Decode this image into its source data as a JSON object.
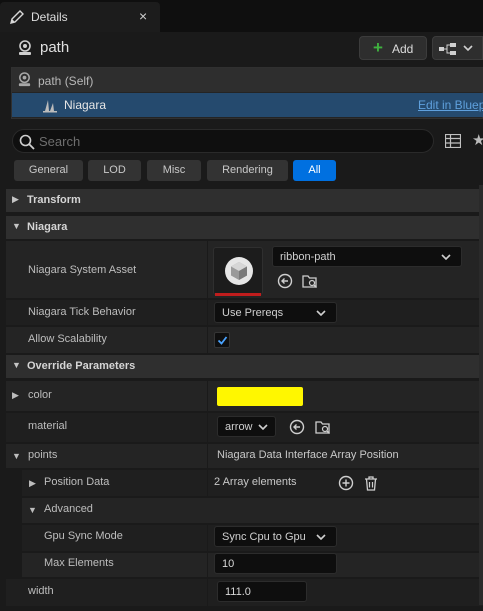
{
  "tab": {
    "title": "Details",
    "close": "×",
    "icon": "pencil-icon"
  },
  "header": {
    "actor_name": "path",
    "add_label": "Add",
    "add_icon": "plus-icon",
    "blueprint_icon": "blueprint-options-icon"
  },
  "tree": {
    "self_label": "path (Self)",
    "component_label": "Niagara",
    "edit_link": "Edit in Bluep"
  },
  "search": {
    "placeholder": "Search"
  },
  "filters": [
    "General",
    "LOD",
    "Misc",
    "Rendering",
    "All"
  ],
  "active_filter": "All",
  "sections": {
    "transform": "Transform",
    "niagara": "Niagara",
    "override": "Override Parameters"
  },
  "niagara": {
    "system_asset_label": "Niagara System Asset",
    "system_asset_value": "ribbon-path",
    "tick_behavior_label": "Niagara Tick Behavior",
    "tick_behavior_value": "Use Prereqs",
    "allow_scalability_label": "Allow Scalability",
    "allow_scalability_checked": true
  },
  "override": {
    "color_label": "color",
    "color_value": "#fff700",
    "material_label": "material",
    "material_value": "arrow",
    "points_label": "points",
    "points_value": "Niagara Data Interface Array Position",
    "position_data_label": "Position Data",
    "position_data_value": "2 Array elements",
    "advanced_label": "Advanced",
    "gpu_sync_label": "Gpu Sync Mode",
    "gpu_sync_value": "Sync Cpu to Gpu",
    "max_elements_label": "Max Elements",
    "max_elements_value": "10",
    "width_label": "width",
    "width_value": "111.0"
  },
  "colors": {
    "accent": "#0070e0",
    "selection": "#254a6e",
    "add_plus": "#3fb13f",
    "thumb_bar": "#c01d1d"
  }
}
